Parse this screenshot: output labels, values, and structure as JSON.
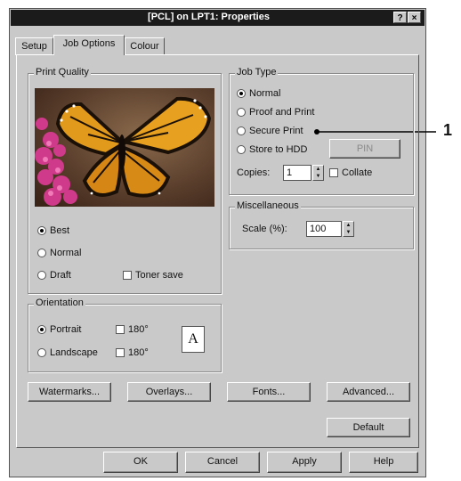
{
  "window": {
    "title": "[PCL] on LPT1: Properties",
    "help_glyph": "?",
    "close_glyph": "×"
  },
  "tabs": [
    {
      "label": "Setup"
    },
    {
      "label": "Job Options"
    },
    {
      "label": "Colour"
    }
  ],
  "print_quality": {
    "legend": "Print Quality",
    "options": [
      {
        "label": "Best",
        "selected": true
      },
      {
        "label": "Normal",
        "selected": false
      },
      {
        "label": "Draft",
        "selected": false
      }
    ],
    "toner_save_label": "Toner save"
  },
  "orientation": {
    "legend": "Orientation",
    "options": [
      {
        "label": "Portrait",
        "selected": true
      },
      {
        "label": "Landscape",
        "selected": false
      }
    ],
    "rotate_labels": [
      "180°",
      "180°"
    ],
    "preview_letter": "A"
  },
  "job_type": {
    "legend": "Job Type",
    "options": [
      {
        "label": "Normal",
        "selected": true
      },
      {
        "label": "Proof and Print",
        "selected": false
      },
      {
        "label": "Secure Print",
        "selected": false
      },
      {
        "label": "Store to HDD",
        "selected": false
      }
    ],
    "pin_button": "PIN",
    "copies_label": "Copies:",
    "copies_value": "1",
    "collate_label": "Collate"
  },
  "miscellaneous": {
    "legend": "Miscellaneous",
    "scale_label": "Scale (%):",
    "scale_value": "100"
  },
  "buttons": {
    "watermarks": "Watermarks...",
    "overlays": "Overlays...",
    "fonts": "Fonts...",
    "advanced": "Advanced...",
    "default": "Default"
  },
  "footer": {
    "ok": "OK",
    "cancel": "Cancel",
    "apply": "Apply",
    "help": "Help"
  },
  "callout": {
    "number": "1"
  }
}
